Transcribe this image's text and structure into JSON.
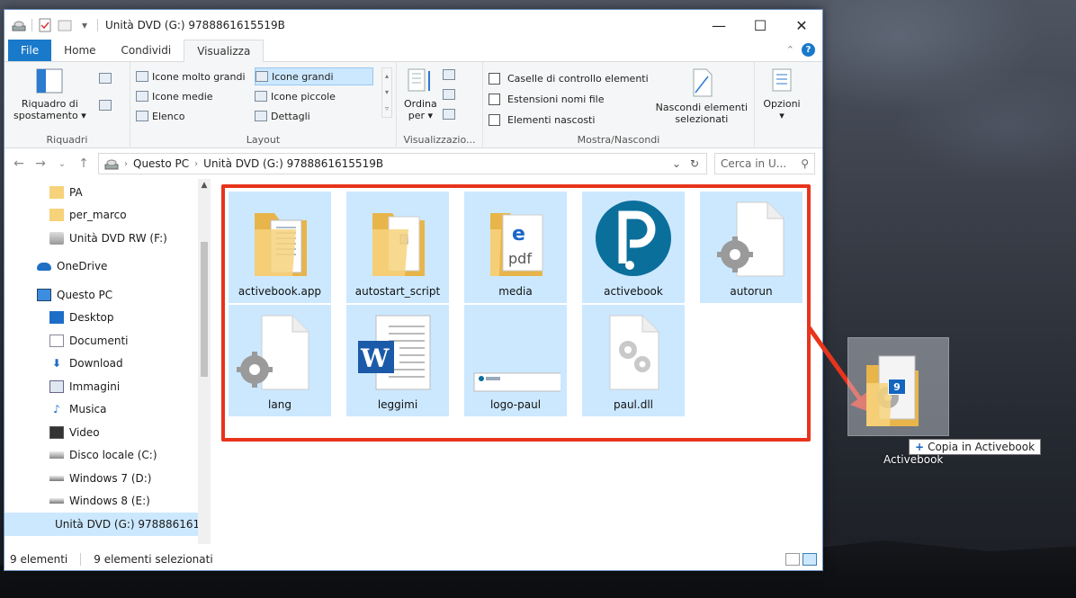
{
  "window": {
    "title": "Unità DVD (G:) 9788861615519B",
    "controls": {
      "minimize": "—",
      "maximize": "☐",
      "close": "✕"
    }
  },
  "tabs": {
    "file": "File",
    "home": "Home",
    "share": "Condividi",
    "view": "Visualizza"
  },
  "ribbon": {
    "panes": {
      "nav_pane_line1": "Riquadro di",
      "nav_pane_line2": "spostamento ▾",
      "label": "Riquadri"
    },
    "layout": {
      "label": "Layout",
      "items": [
        "Icone molto grandi",
        "Icone grandi",
        "Icone medie",
        "Icone piccole",
        "Elenco",
        "Dettagli"
      ]
    },
    "current_view": {
      "sort_line1": "Ordina",
      "sort_line2": "per ▾",
      "label": "Visualizzazio..."
    },
    "show_hide": {
      "label": "Mostra/Nascondi",
      "checkbox_items": "Caselle di controllo elementi",
      "checkbox_extensions": "Estensioni nomi file",
      "checkbox_hidden": "Elementi nascosti",
      "hide_selected_line1": "Nascondi elementi",
      "hide_selected_line2": "selezionati"
    },
    "options": {
      "label": "Opzioni",
      "arrow": "▾"
    }
  },
  "address": {
    "crumbs": [
      "Questo PC",
      "Unità DVD (G:) 9788861615519B"
    ],
    "search_placeholder": "Cerca in U..."
  },
  "nav": {
    "items": [
      {
        "label": "PA",
        "icon": "folder-icon"
      },
      {
        "label": "per_marco",
        "icon": "folder-icon"
      },
      {
        "label": "Unità DVD RW (F:)",
        "icon": "dvd-drive-icon"
      },
      {
        "label": "OneDrive",
        "icon": "cloud-icon"
      },
      {
        "label": "Questo PC",
        "icon": "computer-icon"
      },
      {
        "label": "Desktop",
        "icon": "desktop-icon"
      },
      {
        "label": "Documenti",
        "icon": "documents-icon"
      },
      {
        "label": "Download",
        "icon": "download-icon"
      },
      {
        "label": "Immagini",
        "icon": "pictures-icon"
      },
      {
        "label": "Musica",
        "icon": "music-icon"
      },
      {
        "label": "Video",
        "icon": "video-icon"
      },
      {
        "label": "Disco locale (C:)",
        "icon": "local-disk-icon"
      },
      {
        "label": "Windows 7 (D:)",
        "icon": "drive-icon"
      },
      {
        "label": "Windows 8 (E:)",
        "icon": "drive-icon"
      },
      {
        "label": "Unità DVD (G:) 978886161",
        "icon": "dvd-drive-icon"
      }
    ]
  },
  "files": [
    {
      "name": "activebook.app",
      "icon": "folder-doc-icon"
    },
    {
      "name": "autostart_script",
      "icon": "folder-icon"
    },
    {
      "name": "media",
      "icon": "folder-pdf-icon"
    },
    {
      "name": "activebook",
      "icon": "pearson-logo-icon"
    },
    {
      "name": "autorun",
      "icon": "settings-file-icon"
    },
    {
      "name": "lang",
      "icon": "settings-file-icon"
    },
    {
      "name": "leggimi",
      "icon": "word-document-icon"
    },
    {
      "name": "logo-paul",
      "icon": "image-thumbnail-icon"
    },
    {
      "name": "paul.dll",
      "icon": "dll-file-icon"
    }
  ],
  "status": {
    "count": "9 elementi",
    "selected": "9 elementi selezionati"
  },
  "drag": {
    "badge": "9",
    "tooltip": "Copia in Activebook",
    "desktop_label": "Activebook"
  },
  "colors": {
    "selection": "#cce8ff",
    "highlight_box": "#e8341c",
    "accent": "#1979ca"
  }
}
